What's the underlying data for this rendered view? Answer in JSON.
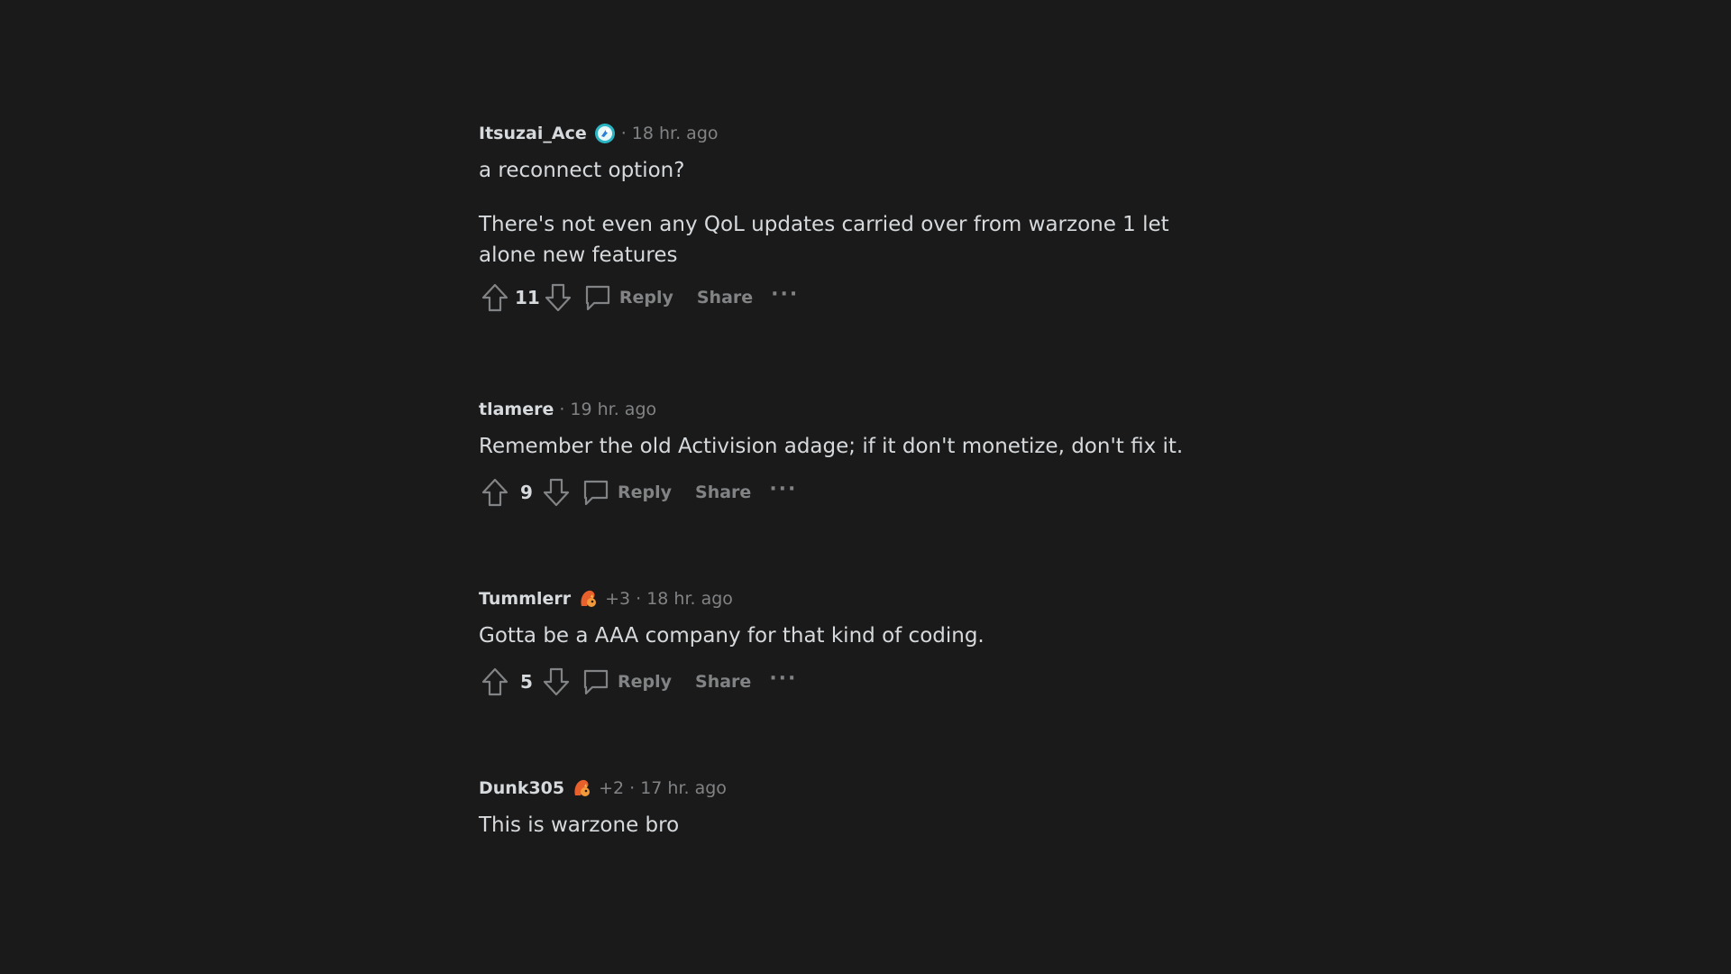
{
  "comments": [
    {
      "author": "Itsuzai_Ace",
      "badge": "blue-orb-icon",
      "flair_extra": "",
      "time": "18 hr. ago",
      "paragraphs": [
        "a reconnect option?",
        "There's not even any QoL updates carried over from warzone 1 let alone new features"
      ],
      "score": "11"
    },
    {
      "author": "tlamere",
      "badge": "",
      "flair_extra": "",
      "time": "19 hr. ago",
      "paragraphs": [
        "Remember the old Activision adage; if it don't monetize, don't fix it."
      ],
      "score": "9"
    },
    {
      "author": "Tummlerr",
      "badge": "squirrel-icon",
      "flair_extra": "+3",
      "time": "18 hr. ago",
      "paragraphs": [
        "Gotta be a AAA company for that kind of coding."
      ],
      "score": "5"
    },
    {
      "author": "Dunk305",
      "badge": "squirrel-icon",
      "flair_extra": "+2",
      "time": "17 hr. ago",
      "paragraphs": [
        "This is warzone bro"
      ],
      "score": ""
    }
  ],
  "actions": {
    "reply": "Reply",
    "share": "Share",
    "more": "···"
  },
  "separator": "·",
  "colors": {
    "background": "#1a1a1b",
    "text": "#d7dadc",
    "muted": "#818384"
  }
}
